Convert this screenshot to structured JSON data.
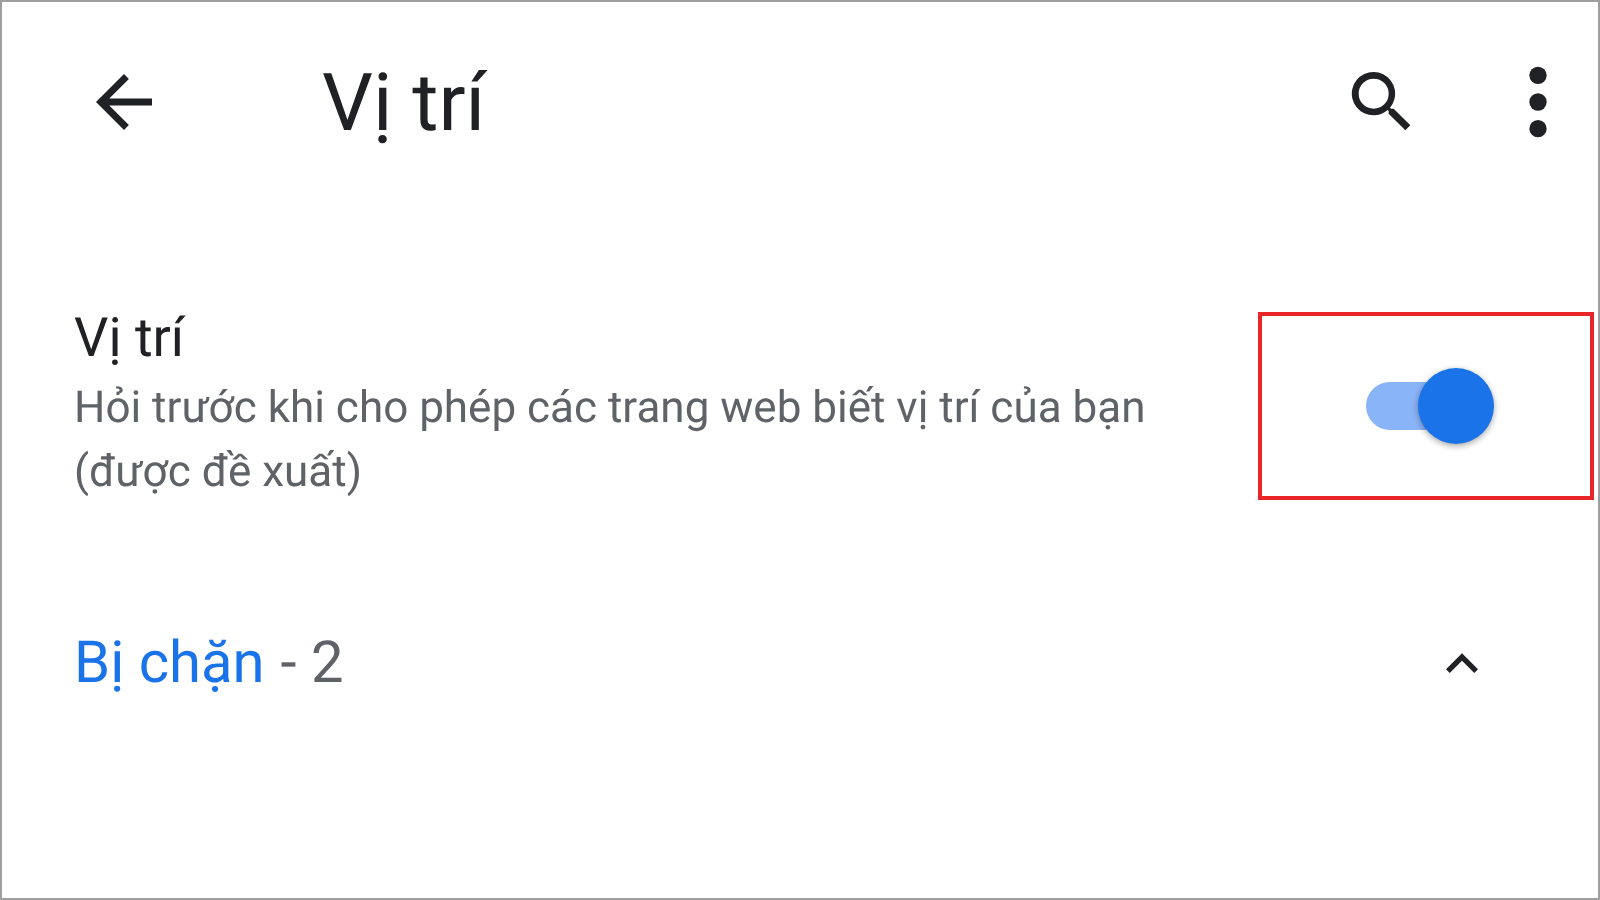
{
  "toolbar": {
    "title": "Vị trí"
  },
  "setting": {
    "title": "Vị trí",
    "description": "Hỏi trước khi cho phép các trang web biết vị trí của bạn (được đề xuất)",
    "on": true,
    "highlighted": true
  },
  "section": {
    "label": "Bị chặn",
    "count": "- 2",
    "expanded": true
  }
}
